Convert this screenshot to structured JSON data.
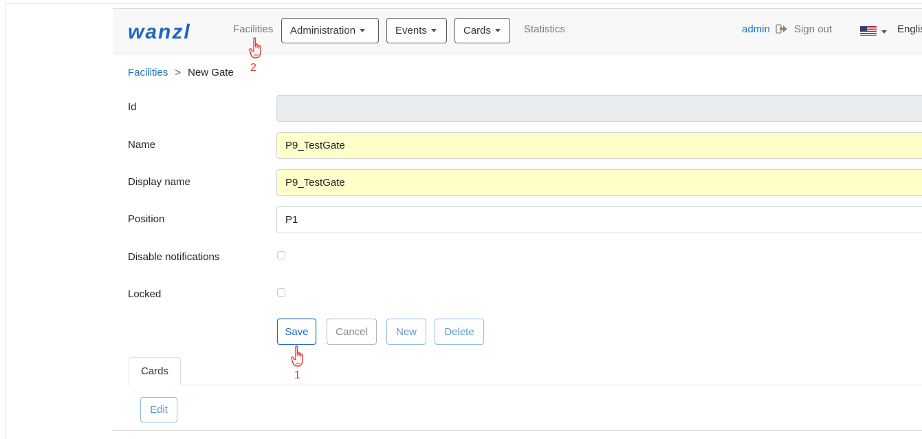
{
  "nav": {
    "brand": "wanzl",
    "facilities": "Facilities",
    "administration": "Administration",
    "events": "Events",
    "cards": "Cards",
    "statistics": "Statistics",
    "user": "admin",
    "sign_out": "Sign out",
    "language": "English"
  },
  "breadcrumb": {
    "parent": "Facilities",
    "separator": ">",
    "current": "New Gate"
  },
  "form": {
    "id": {
      "label": "Id",
      "value": ""
    },
    "name": {
      "label": "Name",
      "value": "P9_TestGate"
    },
    "display_name": {
      "label": "Display name",
      "value": "P9_TestGate"
    },
    "position": {
      "label": "Position",
      "value": "P1"
    },
    "disable_notifications": {
      "label": "Disable notifications",
      "checked": false
    },
    "locked": {
      "label": "Locked",
      "checked": false
    }
  },
  "actions": {
    "save": "Save",
    "cancel": "Cancel",
    "new": "New",
    "delete": "Delete"
  },
  "tabs": {
    "cards": "Cards",
    "edit": "Edit"
  },
  "annotations": {
    "step_one": "1",
    "step_two": "2"
  },
  "colors": {
    "brand": "#1e67bd",
    "link": "#1a73c9",
    "required_field": "#ffffc9",
    "annotation": "#e53935"
  }
}
